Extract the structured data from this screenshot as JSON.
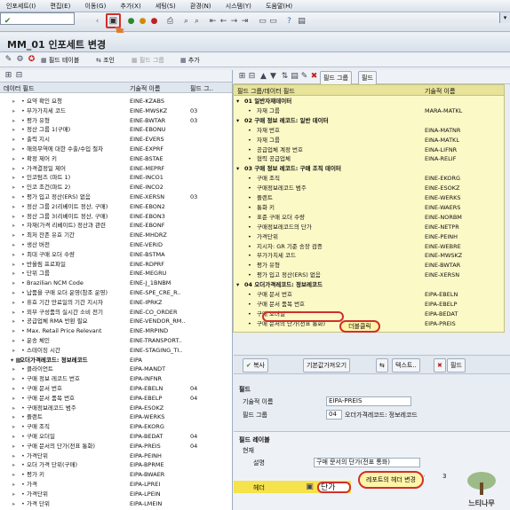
{
  "menu": [
    "인포세트(I)",
    "편집(E)",
    "이동(G)",
    "추가(X)",
    "세팅(S)",
    "환경(N)",
    "시스템(Y)",
    "도움말(H)"
  ],
  "title": "MM_01 인포세트 변경",
  "app_toolbar": {
    "field_table": "필드 테이블",
    "join": "조인",
    "field_group": "필드 그룹",
    "add": "추가"
  },
  "left": {
    "col_data_field": "데이터 필드",
    "col_tech_name": "기술적 이름",
    "col_field_group": "필드 그..",
    "rows": [
      {
        "name": "요약 확인 요청",
        "tech": "EINE-KZABS",
        "grp": ""
      },
      {
        "name": "부가가치세 코드",
        "tech": "EINE-MWSKZ",
        "grp": "03"
      },
      {
        "name": "평가 유형",
        "tech": "EINE-BWTAR",
        "grp": "03"
      },
      {
        "name": "정산 그룹 1(구매)",
        "tech": "EINE-EBONU",
        "grp": ""
      },
      {
        "name": "출력 지시",
        "tech": "EINE-EVERS",
        "grp": ""
      },
      {
        "name": "해외무역에 대한 수출/수입 절차",
        "tech": "EINE-EXPRF",
        "grp": ""
      },
      {
        "name": "확정 제어 키",
        "tech": "EINE-BSTAE",
        "grp": ""
      },
      {
        "name": "가격결정일 제어",
        "tech": "EINE-MEPRF",
        "grp": ""
      },
      {
        "name": "인코텀즈 (파트 1)",
        "tech": "EINE-INCO1",
        "grp": ""
      },
      {
        "name": "인코 조건(파트 2)",
        "tech": "EINE-INCO2",
        "grp": ""
      },
      {
        "name": "평가 입고 정산(ERS) 없음",
        "tech": "EINE-XERSN",
        "grp": "03"
      },
      {
        "name": "정산 그룹 2(리베이트 정산, 구매)",
        "tech": "EINE-EBON2",
        "grp": ""
      },
      {
        "name": "정산 그룹 3(리베이트 정산, 구매)",
        "tech": "EINE-EBON3",
        "grp": ""
      },
      {
        "name": "자재(가격 리베이트) 정산과 관련",
        "tech": "EINE-EBONF",
        "grp": ""
      },
      {
        "name": "최저 잔존 유효 기간",
        "tech": "EINE-MHDRZ",
        "grp": ""
      },
      {
        "name": "생산 버전",
        "tech": "EINE-VERID",
        "grp": ""
      },
      {
        "name": "최대 구매 오더 수량",
        "tech": "EINE-BSTMA",
        "grp": ""
      },
      {
        "name": "반올림 프로파일",
        "tech": "EINE-RDPRF",
        "grp": ""
      },
      {
        "name": "단위 그룹",
        "tech": "EINE-MEGRU",
        "grp": ""
      },
      {
        "name": "Brazilian NCM Code",
        "tech": "EINE-J_1BNBM",
        "grp": ""
      },
      {
        "name": "납품을 구매 오더 운영(참조 운영)",
        "tech": "EINE-SPE_CRE_R..",
        "grp": ""
      },
      {
        "name": "휴효 기간 만료일의 기간 지시자",
        "tech": "EINE-IPRKZ",
        "grp": ""
      },
      {
        "name": "외부 구성품의 실시간 소비 전기",
        "tech": "EINE-CO_ORDER",
        "grp": ""
      },
      {
        "name": "공급업체 RMA 반환 필요",
        "tech": "EINE-VENDOR_RM..",
        "grp": ""
      },
      {
        "name": "Max. Retail Price Relevant",
        "tech": "EINE-MRPIND",
        "grp": ""
      },
      {
        "name": "운송 체인",
        "tech": "EINE-TRANSPORT..",
        "grp": ""
      },
      {
        "name": "스테이징 시간",
        "tech": "EINE-STAGING_TI..",
        "grp": ""
      },
      {
        "name": "오더가격레코드: 정보레코드",
        "tech": "EIPA",
        "grp": "",
        "hdr": true
      },
      {
        "name": "클라이언트",
        "tech": "EIPA-MANDT",
        "grp": ""
      },
      {
        "name": "구매 정보 레코드 번호",
        "tech": "EIPA-INFNR",
        "grp": ""
      },
      {
        "name": "구매 문서 번호",
        "tech": "EIPA-EBELN",
        "grp": "04"
      },
      {
        "name": "구매 문서 품목 번호",
        "tech": "EIPA-EBELP",
        "grp": "04"
      },
      {
        "name": "구매정보레코드 범주",
        "tech": "EIPA-ESOKZ",
        "grp": ""
      },
      {
        "name": "플랜트",
        "tech": "EIPA-WERKS",
        "grp": ""
      },
      {
        "name": "구매 조직",
        "tech": "EIPA-EKORG",
        "grp": ""
      },
      {
        "name": "구매 오더일",
        "tech": "EIPA-BEDAT",
        "grp": "04"
      },
      {
        "name": "구매 문서의 단가(전표 통화)",
        "tech": "EIPA-PREIS",
        "grp": "04",
        "sel": true
      },
      {
        "name": "가격단위",
        "tech": "EIPA-PEINH",
        "grp": ""
      },
      {
        "name": "오더 가격 단위(구매)",
        "tech": "EIPA-BPRME",
        "grp": ""
      },
      {
        "name": "평가 키",
        "tech": "EIPA-BWAER",
        "grp": ""
      },
      {
        "name": "가격",
        "tech": "EIPA-LPREI",
        "grp": ""
      },
      {
        "name": "가격단위",
        "tech": "EIPA-LPEIN",
        "grp": ""
      },
      {
        "name": "가격 단위",
        "tech": "EIPA-LMEIN",
        "grp": ""
      }
    ]
  },
  "right": {
    "toolbar_field_group": "필드 그룹",
    "toolbar_field": "필드",
    "col_group": "필드 그룹/데이터 필드",
    "col_tech": "기술적 이름",
    "rows": [
      {
        "name": "01 일반자재데이터",
        "tech": "",
        "g": true
      },
      {
        "name": "자재 그룹",
        "tech": "MARA-MATKL"
      },
      {
        "name": "02 구매 정보 레코드: 일반 데이터",
        "tech": "",
        "g": true
      },
      {
        "name": "자재 번호",
        "tech": "EINA-MATNR"
      },
      {
        "name": "자재 그룹",
        "tech": "EINA-MATKL"
      },
      {
        "name": "공급업체 계정 번호",
        "tech": "EINA-LIFNR"
      },
      {
        "name": "협력 공급업체",
        "tech": "EINA-RELIF"
      },
      {
        "name": "03 구매 정보 레코드: 구매 조직 데이터",
        "tech": "",
        "g": true
      },
      {
        "name": "구매 조직",
        "tech": "EINE-EKORG"
      },
      {
        "name": "구매정보레코드 범주",
        "tech": "EINE-ESOKZ"
      },
      {
        "name": "플랜트",
        "tech": "EINE-WERKS"
      },
      {
        "name": "통화 키",
        "tech": "EINE-WAERS"
      },
      {
        "name": "표준 구매 오더 수량",
        "tech": "EINE-NORBM"
      },
      {
        "name": "구매정보레코드의 단가",
        "tech": "EINE-NETPR"
      },
      {
        "name": "가격단위",
        "tech": "EINE-PEINH"
      },
      {
        "name": "지시자: GR 기준 송장 검증",
        "tech": "EINE-WEBRE"
      },
      {
        "name": "부가가치세 코드",
        "tech": "EINE-MWSKZ"
      },
      {
        "name": "평가 유형",
        "tech": "EINE-BWTAR"
      },
      {
        "name": "평가 입고 정산(ERS) 없음",
        "tech": "EINE-XERSN"
      },
      {
        "name": "04 오더가격레코드: 정보레코드",
        "tech": "",
        "g": true
      },
      {
        "name": "구매 문서 번호",
        "tech": "EIPA-EBELN"
      },
      {
        "name": "구매 문서 품목 번호",
        "tech": "EIPA-EBELP"
      },
      {
        "name": "구매 오더일",
        "tech": "EIPA-BEDAT"
      },
      {
        "name": "구매 문서의 단가(전표 통화)",
        "tech": "EIPA-PREIS"
      }
    ],
    "dblclick_callout": "더블클릭",
    "btn_copy": "복사",
    "btn_default": "기본값가져오기",
    "btn_text": "텍스트..",
    "btn_field": "필드",
    "field_section": "필드",
    "lbl_tech": "기술적 이름",
    "val_tech": "EIPA-PREIS",
    "lbl_group": "필드 그룹",
    "val_group_no": "04",
    "val_group_name": "오더가격레코드: 정보레코드",
    "label_section": "필드 레이블",
    "lbl_current": "현재",
    "lbl_long": "설명",
    "val_long": "구매 문서의 단가(전표 통화)",
    "lbl_header": "헤더",
    "val_header": "단가",
    "header_callout": "레포트의 헤더 변경",
    "dots": "3"
  },
  "watermark": "느티나무"
}
